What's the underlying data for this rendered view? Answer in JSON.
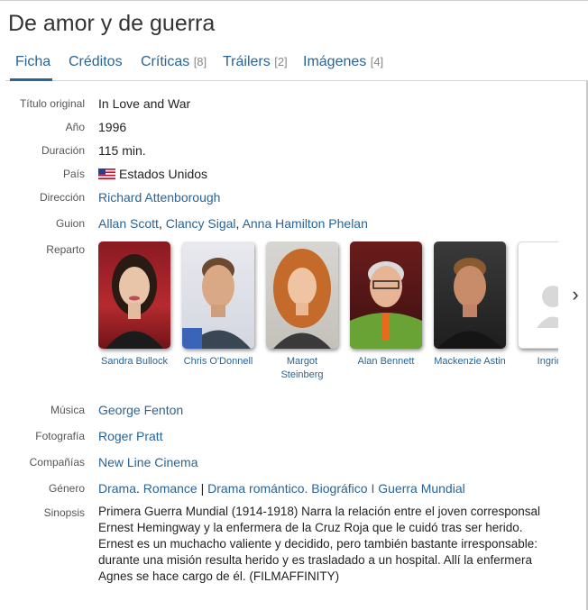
{
  "page": {
    "title": "De amor y de guerra"
  },
  "tabs": [
    {
      "label": "Ficha",
      "count": ""
    },
    {
      "label": "Créditos",
      "count": ""
    },
    {
      "label": "Críticas",
      "count": "[8]"
    },
    {
      "label": "Tráilers",
      "count": "[2]"
    },
    {
      "label": "Imágenes",
      "count": "[4]"
    }
  ],
  "labels": {
    "original_title": "Título original",
    "year": "Año",
    "duration": "Duración",
    "country": "País",
    "director": "Dirección",
    "writer": "Guion",
    "cast": "Reparto",
    "music": "Música",
    "photography": "Fotografía",
    "companies": "Compañías",
    "genre": "Género",
    "synopsis": "Sinopsis"
  },
  "film": {
    "original_title": "In Love and War",
    "year": "1996",
    "duration": "115 min.",
    "country": "Estados Unidos",
    "country_flag_icon": "us-flag-icon",
    "director": "Richard Attenborough",
    "writers": [
      "Allan Scott",
      "Clancy Sigal",
      "Anna Hamilton Phelan"
    ],
    "writer_sep": ",",
    "cast": [
      {
        "name": "Sandra Bullock"
      },
      {
        "name": "Chris O'Donnell"
      },
      {
        "name": "Margot Steinberg"
      },
      {
        "name": "Alan Bennett"
      },
      {
        "name": "Mackenzie Astin"
      },
      {
        "name": "Ingrid L"
      }
    ],
    "music": "George Fenton",
    "photography": "Roger Pratt",
    "company": "New Line Cinema",
    "genre": {
      "drama": "Drama",
      "dot": ".",
      "romance": "Romance",
      "bar": "|",
      "drama_romantico": "Drama romántico",
      "biografico": "Biográfico",
      "guerra": "Guerra Mundial",
      "bar_small": "I"
    },
    "synopsis": [
      "Primera Guerra Mundial (1914-1918) Narra la relación entre el joven corresponsal",
      "Ernest Hemingway y la enfermera de la Cruz Roja que le cuidó tras ser herido.",
      "Ernest es un muchacho valiente y decidido, pero también bastante irresponsable:",
      "durante una misión resulta herido y es trasladado a un hospital. Allí la enfermera",
      "Agnes se hace cargo de él. (FILMAFFINITY)"
    ]
  },
  "icons": {
    "next": "chevron-right-icon",
    "placeholder": "person-placeholder-icon"
  },
  "colors": {
    "link": "#2a6496",
    "text": "#222222",
    "label": "#555555"
  }
}
